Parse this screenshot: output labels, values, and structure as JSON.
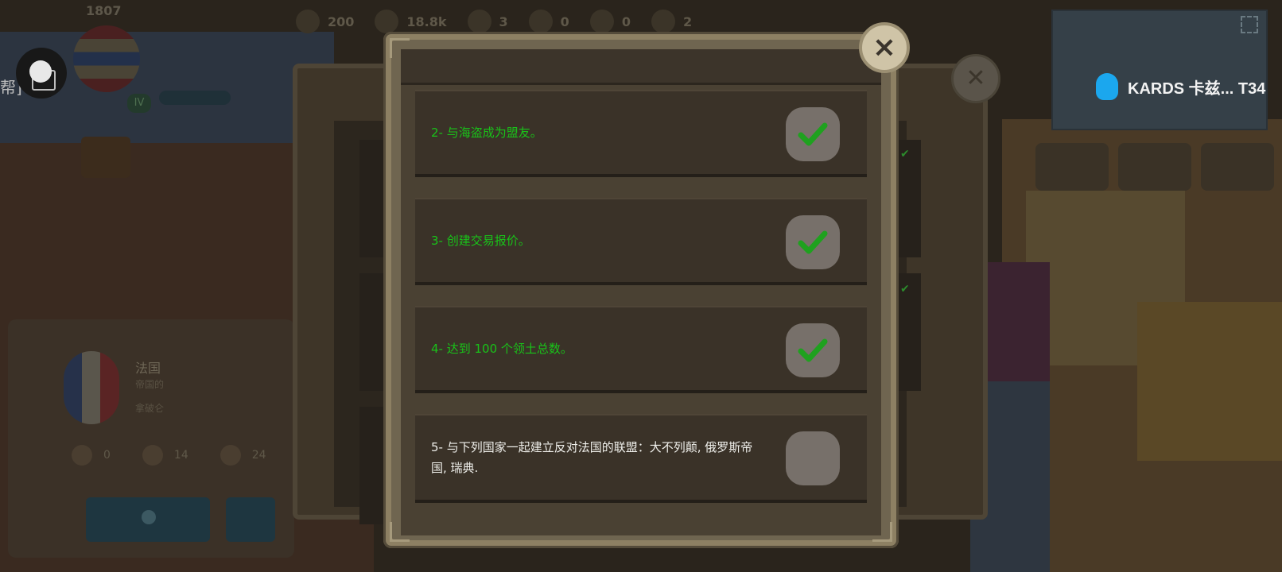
{
  "header": {
    "year": "1807",
    "level": "IV",
    "resources": [
      "200",
      "18.8k",
      "3",
      "0",
      "0",
      "2"
    ]
  },
  "chat": {
    "tag": "帮]"
  },
  "country": {
    "name": "法国",
    "sub1": "帝国的",
    "sub2": "拿破仑",
    "stats": [
      "0",
      "14",
      "24"
    ]
  },
  "minimap": {
    "qq_label": "KARDS 卡兹... T34"
  },
  "modal": {
    "close_icon": "×",
    "tasks": [
      {
        "label": "2- 与海盗成为盟友。",
        "completed": true
      },
      {
        "label": "3- 创建交易报价。",
        "completed": true
      },
      {
        "label": "4- 达到 100 个领土总数。",
        "completed": true
      },
      {
        "label": "5- 与下列国家一起建立反对法国的联盟：大不列颠, 俄罗斯帝国, 瑞典.",
        "completed": false
      }
    ]
  },
  "colors": {
    "done_text": "#19c219",
    "pending_text": "#f0f0ec",
    "check": "#1fa11f",
    "qq_blue": "#1ba7ee"
  }
}
